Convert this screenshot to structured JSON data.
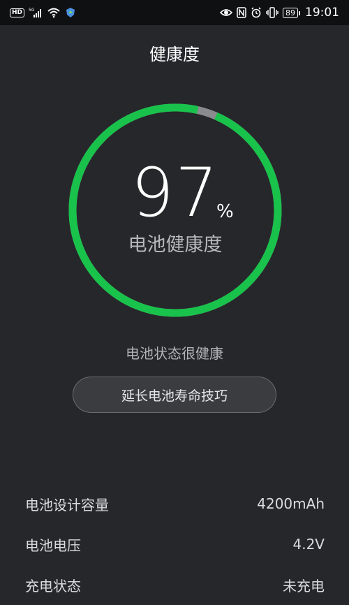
{
  "status_bar": {
    "network_badge": "HD",
    "signal_type": "5G",
    "battery_level": "89",
    "time": "19:01",
    "icons": [
      "hd-icon",
      "signal-5g-icon",
      "wifi-icon",
      "shield-app-icon",
      "eye-icon",
      "nfc-icon",
      "alarm-icon",
      "vibrate-icon",
      "battery-icon"
    ]
  },
  "header": {
    "title": "健康度"
  },
  "health": {
    "value": "97",
    "percent_sign": "%",
    "label": "电池健康度",
    "fraction": 0.97,
    "colors": {
      "ring": "#19c24b",
      "ring_remainder": "#8a8b8e"
    }
  },
  "status_text": "电池状态很健康",
  "tips_button": {
    "label": "延长电池寿命技巧"
  },
  "info_rows": [
    {
      "label": "电池设计容量",
      "value": "4200mAh"
    },
    {
      "label": "电池电压",
      "value": "4.2V"
    },
    {
      "label": "充电状态",
      "value": "未充电"
    }
  ]
}
